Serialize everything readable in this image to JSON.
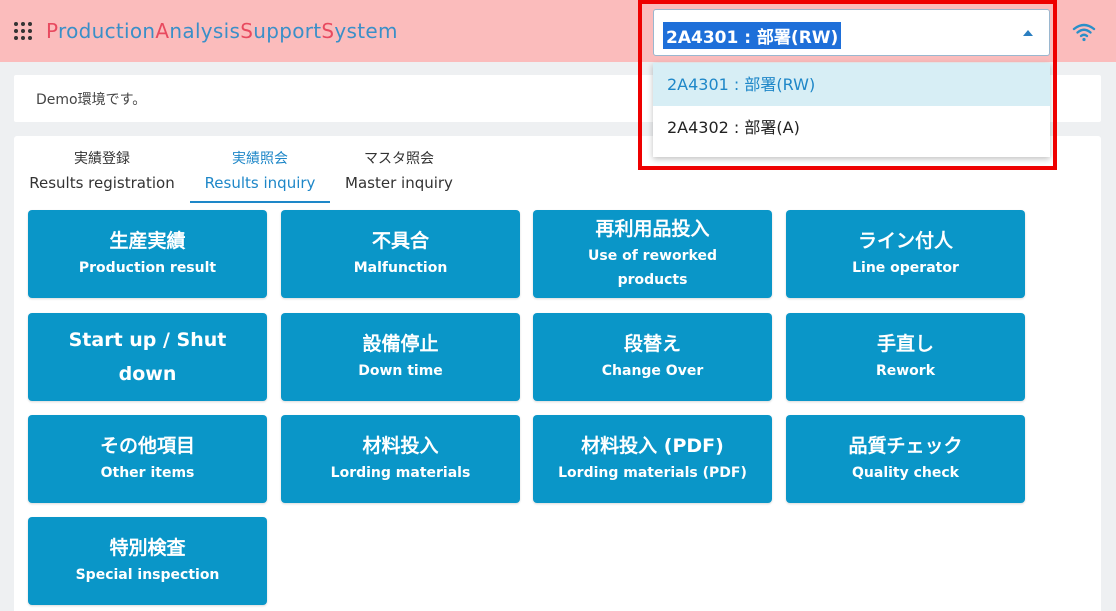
{
  "header": {
    "title_parts": [
      {
        "t": "P",
        "cap": true
      },
      {
        "t": "roduction",
        "cap": false
      },
      {
        "t": "A",
        "cap": true
      },
      {
        "t": "nalysis",
        "cap": false
      },
      {
        "t": "S",
        "cap": true
      },
      {
        "t": "upport",
        "cap": false
      },
      {
        "t": "S",
        "cap": true
      },
      {
        "t": "ystem",
        "cap": false
      }
    ],
    "icons": {
      "menu": "grid-dots-icon",
      "network": "wifi-icon"
    }
  },
  "department_select": {
    "value": "2A4301 : 部署(RW)",
    "options": [
      "2A4301 : 部署(RW)",
      "2A4302 : 部署(A)"
    ],
    "selected_index": 0
  },
  "notice": "Demo環境です。",
  "tabs": [
    {
      "jp": "実績登録",
      "en": "Results registration"
    },
    {
      "jp": "実績照会",
      "en": "Results inquiry"
    },
    {
      "jp": "マスタ照会",
      "en": "Master inquiry"
    }
  ],
  "active_tab": 1,
  "buttons": [
    {
      "jp": "生産実績",
      "en": "Production result"
    },
    {
      "jp": "不具合",
      "en": "Malfunction"
    },
    {
      "jp": "再利用品投入",
      "en": "Use of reworked products"
    },
    {
      "jp": "ライン付人",
      "en": "Line operator"
    },
    {
      "jp": "Start up / Shut down",
      "en": ""
    },
    {
      "jp": "設備停止",
      "en": "Down time"
    },
    {
      "jp": "段替え",
      "en": "Change Over"
    },
    {
      "jp": "手直し",
      "en": "Rework"
    },
    {
      "jp": "その他項目",
      "en": "Other items"
    },
    {
      "jp": "材料投入",
      "en": "Lording materials"
    },
    {
      "jp": "材料投入 (PDF)",
      "en": "Lording materials (PDF)"
    },
    {
      "jp": "品質チェック",
      "en": "Quality check"
    },
    {
      "jp": "特別検査",
      "en": "Special inspection"
    }
  ],
  "colors": {
    "header_bg": "#fbbcbc",
    "title_blue": "#3a8fc8",
    "title_red": "#e84a5f",
    "button_bg": "#0a96c8",
    "accent": "#1e87c8",
    "highlight": "#ee0000"
  }
}
